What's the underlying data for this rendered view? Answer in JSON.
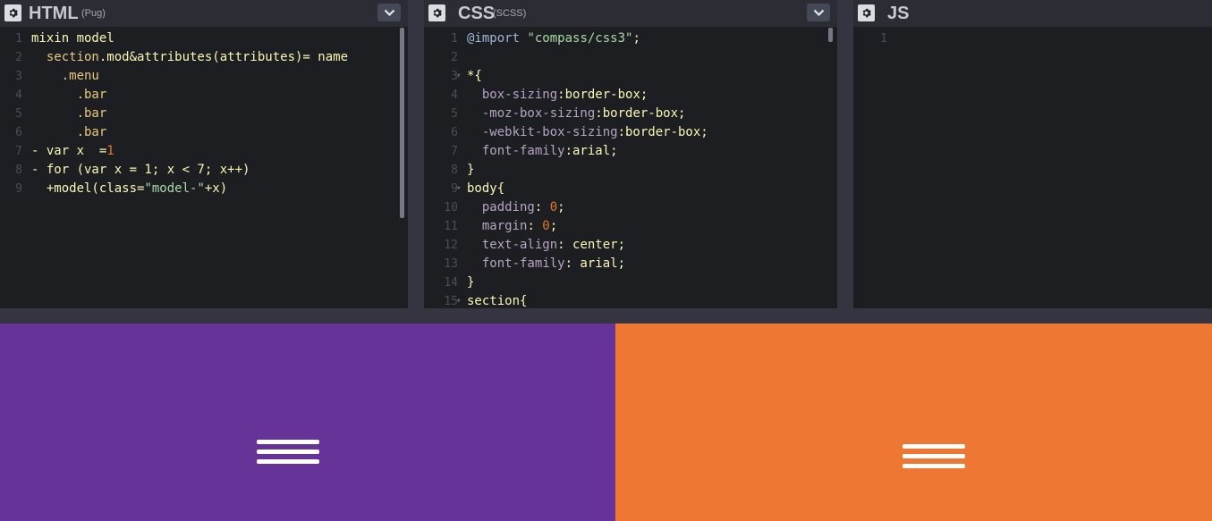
{
  "panels": {
    "html": {
      "title": "HTML",
      "subtitle": "(Pug)",
      "lines": [
        {
          "n": "1",
          "parts": [
            {
              "t": "mixin model",
              "c": "c-def"
            }
          ]
        },
        {
          "n": "2",
          "parts": [
            {
              "t": "  section",
              "c": "c-cls"
            },
            {
              "t": ".mod&attributes(attributes)= name",
              "c": "c-def"
            }
          ]
        },
        {
          "n": "3",
          "parts": [
            {
              "t": "    .menu",
              "c": "c-cls"
            }
          ]
        },
        {
          "n": "4",
          "parts": [
            {
              "t": "      .bar",
              "c": "c-cls"
            }
          ]
        },
        {
          "n": "5",
          "parts": [
            {
              "t": "      .bar",
              "c": "c-cls"
            }
          ]
        },
        {
          "n": "6",
          "parts": [
            {
              "t": "      .bar",
              "c": "c-cls"
            }
          ]
        },
        {
          "n": "7",
          "parts": [
            {
              "t": "- var x  =",
              "c": "c-def"
            },
            {
              "t": "1",
              "c": "c-num"
            }
          ]
        },
        {
          "n": "8",
          "parts": [
            {
              "t": "- for (var x = 1; x < 7; x++)",
              "c": "c-def"
            }
          ]
        },
        {
          "n": "9",
          "parts": [
            {
              "t": "  +model(class=",
              "c": "c-def"
            },
            {
              "t": "\"model-\"",
              "c": "c-str"
            },
            {
              "t": "+x)",
              "c": "c-def"
            }
          ]
        }
      ]
    },
    "css": {
      "title": "CSS",
      "subtitle": "(SCSS)",
      "lines": [
        {
          "n": "1",
          "parts": [
            {
              "t": "@import",
              "c": "c-kw"
            },
            {
              "t": " \"compass/css3\"",
              "c": "c-str"
            },
            {
              "t": ";",
              "c": "c-def"
            }
          ]
        },
        {
          "n": "2",
          "parts": []
        },
        {
          "n": "3",
          "fold": true,
          "parts": [
            {
              "t": "*{",
              "c": "c-def"
            }
          ]
        },
        {
          "n": "4",
          "parts": [
            {
              "t": "  box-sizing",
              "c": "c-prop"
            },
            {
              "t": ":border-box;",
              "c": "c-def"
            }
          ]
        },
        {
          "n": "5",
          "parts": [
            {
              "t": "  -moz-box-sizing",
              "c": "c-prop"
            },
            {
              "t": ":border-box;",
              "c": "c-def"
            }
          ]
        },
        {
          "n": "6",
          "parts": [
            {
              "t": "  -webkit-box-sizing",
              "c": "c-prop"
            },
            {
              "t": ":border-box;",
              "c": "c-def"
            }
          ]
        },
        {
          "n": "7",
          "parts": [
            {
              "t": "  font-family",
              "c": "c-prop"
            },
            {
              "t": ":arial;",
              "c": "c-def"
            }
          ]
        },
        {
          "n": "8",
          "parts": [
            {
              "t": "}",
              "c": "c-def"
            }
          ]
        },
        {
          "n": "9",
          "fold": true,
          "parts": [
            {
              "t": "body{",
              "c": "c-def"
            }
          ]
        },
        {
          "n": "10",
          "parts": [
            {
              "t": "  padding",
              "c": "c-prop"
            },
            {
              "t": ": ",
              "c": "c-def"
            },
            {
              "t": "0",
              "c": "c-num"
            },
            {
              "t": ";",
              "c": "c-def"
            }
          ]
        },
        {
          "n": "11",
          "parts": [
            {
              "t": "  margin",
              "c": "c-prop"
            },
            {
              "t": ": ",
              "c": "c-def"
            },
            {
              "t": "0",
              "c": "c-num"
            },
            {
              "t": ";",
              "c": "c-def"
            }
          ]
        },
        {
          "n": "12",
          "parts": [
            {
              "t": "  text-align",
              "c": "c-prop"
            },
            {
              "t": ": center;",
              "c": "c-def"
            }
          ]
        },
        {
          "n": "13",
          "parts": [
            {
              "t": "  font-family",
              "c": "c-prop"
            },
            {
              "t": ": arial;",
              "c": "c-def"
            }
          ]
        },
        {
          "n": "14",
          "parts": [
            {
              "t": "}",
              "c": "c-def"
            }
          ]
        },
        {
          "n": "15",
          "fold": true,
          "parts": [
            {
              "t": "section{",
              "c": "c-def"
            }
          ]
        }
      ]
    },
    "js": {
      "title": "JS",
      "subtitle": "",
      "lines": [
        {
          "n": "1",
          "parts": []
        }
      ]
    }
  },
  "result": {
    "tiles": [
      {
        "name": "model-1",
        "color": "#663399"
      },
      {
        "name": "model-2",
        "color": "#ee7733"
      }
    ]
  },
  "icons": {
    "settings": "gear-icon",
    "collapse": "chevron-down-icon",
    "menu": "hamburger-menu-icon"
  }
}
